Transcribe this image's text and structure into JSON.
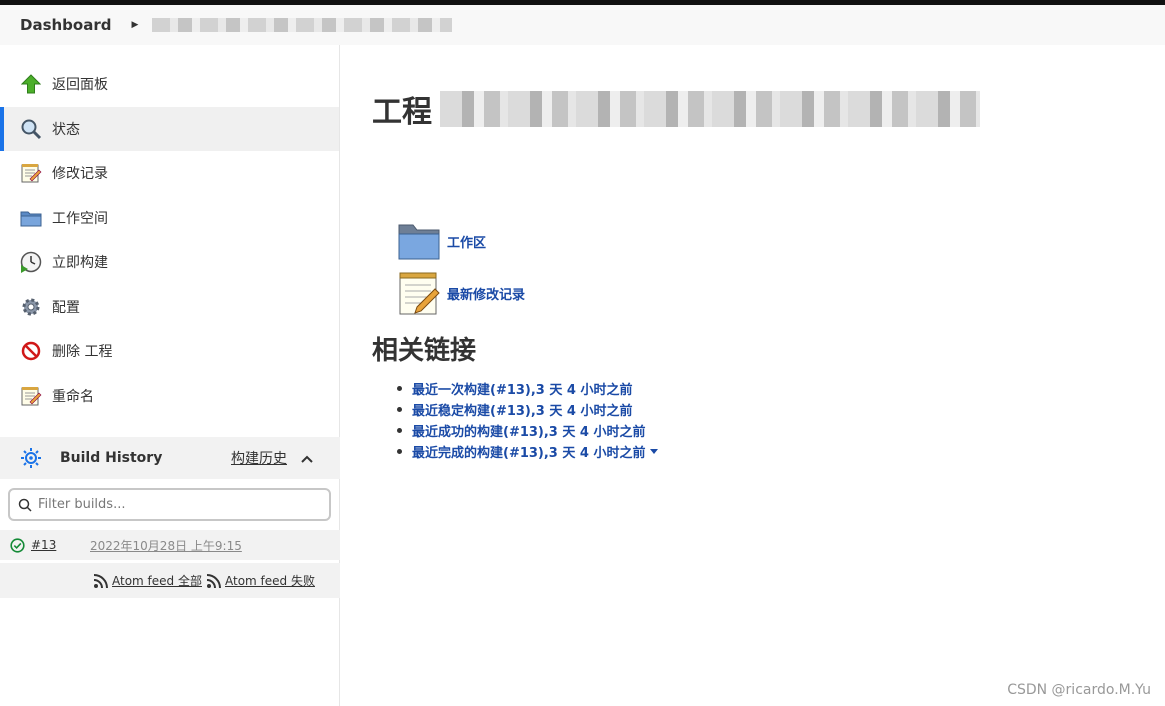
{
  "breadcrumb": {
    "home": "Dashboard",
    "separator": "›"
  },
  "sidebar": {
    "tasks": [
      {
        "label": "返回面板",
        "icon": "up-arrow-icon"
      },
      {
        "label": "状态",
        "icon": "magnifier-icon",
        "active": true
      },
      {
        "label": "修改记录",
        "icon": "notepad-icon"
      },
      {
        "label": "工作空间",
        "icon": "folder-icon"
      },
      {
        "label": "立即构建",
        "icon": "clock-icon"
      },
      {
        "label": "配置",
        "icon": "gear-icon"
      },
      {
        "label": "删除 工程",
        "icon": "no-entry-icon"
      },
      {
        "label": "重命名",
        "icon": "notepad-icon"
      }
    ]
  },
  "build_history": {
    "title": "Build History",
    "trend_link": "构建历史",
    "filter_placeholder": "Filter builds...",
    "builds": [
      {
        "number": "#13",
        "time": "2022年10月28日 上午9:15",
        "status": "success"
      }
    ],
    "feeds": {
      "all": "Atom feed 全部",
      "failed": "Atom feed 失败"
    }
  },
  "main": {
    "title_prefix": "工程",
    "links": {
      "workspace": "工作区",
      "changes": "最新修改记录"
    },
    "related_title": "相关链接",
    "permalinks": [
      "最近一次构建(#13),3 天 4 小时之前",
      "最近稳定构建(#13),3 天 4 小时之前",
      "最近成功的构建(#13),3 天 4 小时之前",
      "最近完成的构建(#13),3 天 4 小时之前"
    ]
  },
  "watermark": "CSDN @ricardo.M.Yu",
  "colors": {
    "link": "#1a4aa6",
    "active_indicator": "#1a73e8",
    "success": "#138a36"
  }
}
